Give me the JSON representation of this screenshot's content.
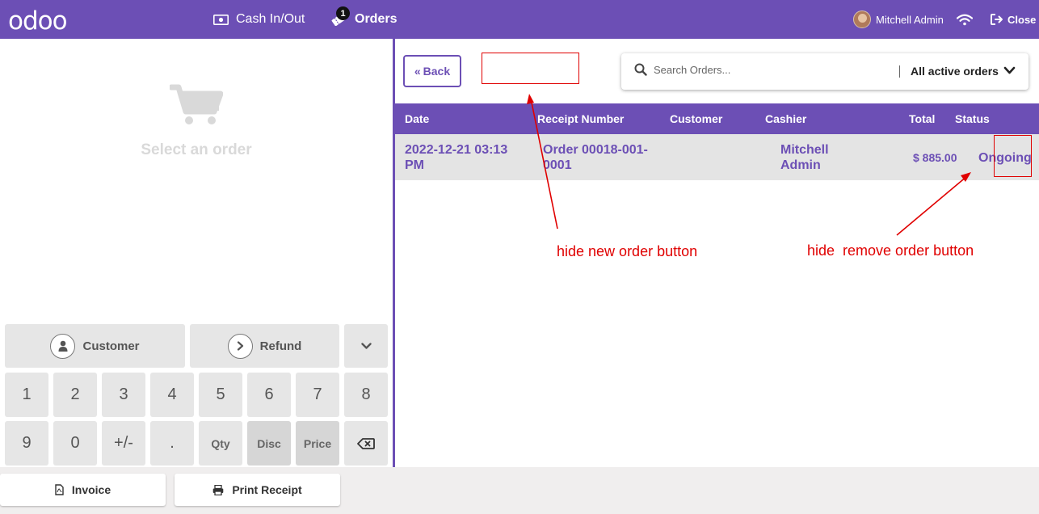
{
  "header": {
    "logo": "odoo",
    "cash_label": "Cash In/Out",
    "orders_label": "Orders",
    "orders_badge": "1",
    "user_name": "Mitchell Admin",
    "close_label": "Close",
    "bg_color": "#6c4fb5"
  },
  "left": {
    "empty_text": "Select an order",
    "customer_label": "Customer",
    "refund_label": "Refund",
    "keys_row1": [
      "1",
      "2",
      "3",
      "4",
      "5",
      "6",
      "7",
      "8"
    ],
    "keys_row2": [
      "9",
      "0",
      "+/-",
      ".",
      "Qty",
      "Disc",
      "Price"
    ]
  },
  "right": {
    "back_label": "Back",
    "search_placeholder": "Search Orders...",
    "filter_label": "All active orders",
    "columns": [
      "Date",
      "Receipt Number",
      "Customer",
      "Cashier",
      "Total",
      "Status"
    ],
    "rows": [
      {
        "date_line1": "2022-12-21 03:13",
        "date_line2": "PM",
        "receipt_line1": "Order 00018-001-",
        "receipt_line2": "0001",
        "customer": "",
        "cashier_line1": "Mitchell",
        "cashier_line2": "Admin",
        "total": "$ 885.00",
        "status": "Ongoing"
      }
    ]
  },
  "annotations": {
    "new_order": "hide new order button",
    "remove_order": "hide  remove order button",
    "color": "#e00000"
  },
  "bottom": {
    "invoice_label": "Invoice",
    "print_label": "Print Receipt"
  },
  "icons": [
    "cash-icon",
    "ticket-icon",
    "wifi-icon",
    "sign-out-icon",
    "cart-icon",
    "user-icon",
    "chevron-right-icon",
    "chevron-down-icon",
    "backspace-icon",
    "search-icon",
    "file-pdf-icon",
    "print-icon"
  ]
}
